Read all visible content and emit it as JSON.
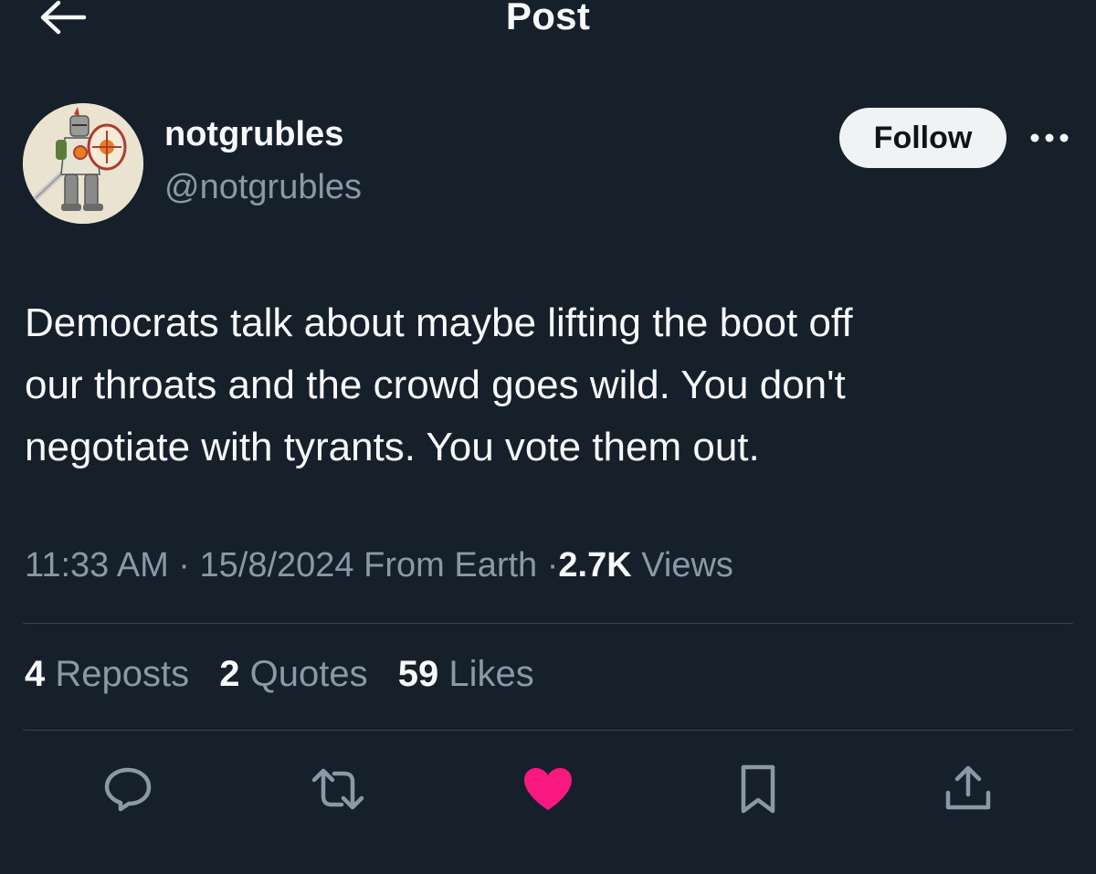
{
  "header": {
    "title": "Post"
  },
  "author": {
    "display_name": "notgrubles",
    "handle": "@notgrubles",
    "follow_label": "Follow"
  },
  "tweet": {
    "text": "Democrats talk about maybe lifting the boot off\nour throats and the crowd goes wild. You don't\nnegotiate with tyrants. You vote them out."
  },
  "meta": {
    "time": "11:33 AM",
    "separator": "·",
    "date": "15/8/2024",
    "source": "From Earth",
    "views_count": "2.7K",
    "views_label": "Views"
  },
  "stats": {
    "reposts_count": "4",
    "reposts_label": "Reposts",
    "quotes_count": "2",
    "quotes_label": "Quotes",
    "likes_count": "59",
    "likes_label": "Likes"
  },
  "actions": {
    "icons": [
      "reply-icon",
      "repost-icon",
      "like-icon",
      "bookmark-icon",
      "share-icon"
    ]
  },
  "colors": {
    "background": "#15202b",
    "text_primary": "#f7f9f9",
    "text_secondary": "#8b98a5",
    "divider": "#38444d",
    "like_active": "#f91880",
    "follow_bg": "#eff3f4"
  }
}
